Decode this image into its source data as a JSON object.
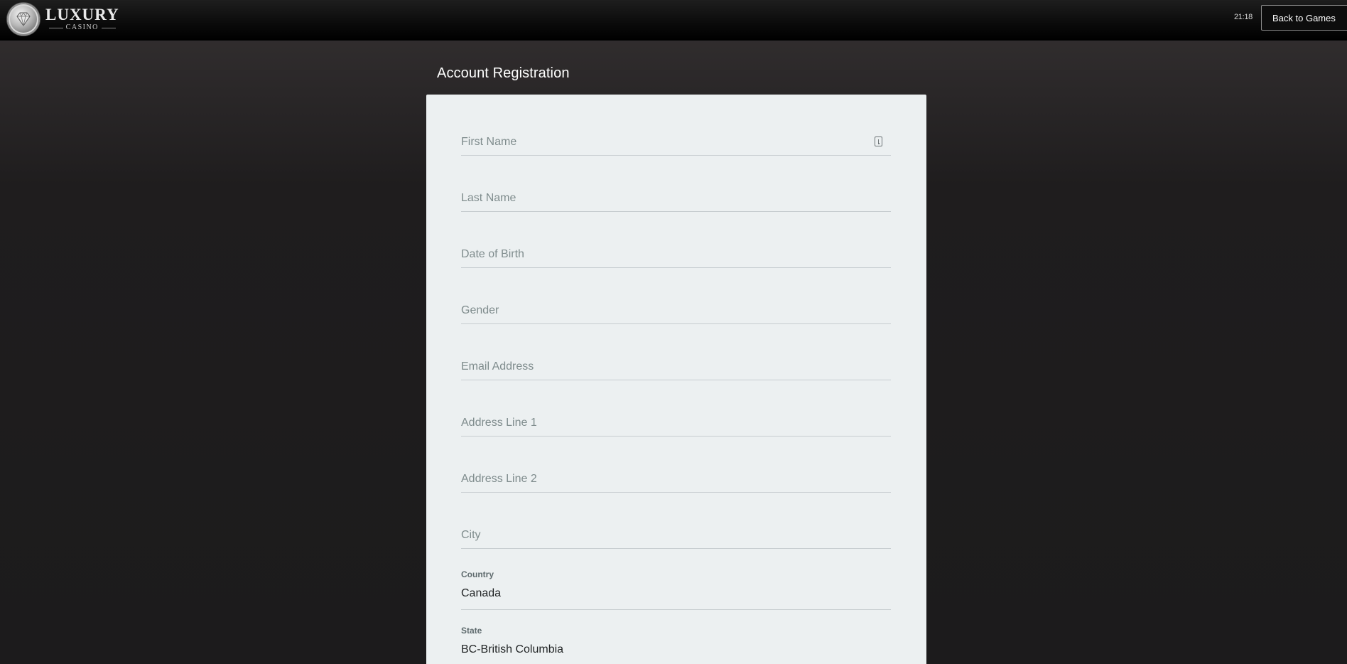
{
  "header": {
    "logo_main": "LUXURY",
    "logo_sub": "CASINO",
    "clock": "21:18",
    "back_button_label": "Back to Games"
  },
  "page": {
    "title": "Account Registration"
  },
  "form": {
    "fields": [
      {
        "name": "first-name",
        "placeholder": "First Name",
        "value": ""
      },
      {
        "name": "last-name",
        "placeholder": "Last Name",
        "value": ""
      },
      {
        "name": "date-of-birth",
        "placeholder": "Date of Birth",
        "value": ""
      },
      {
        "name": "gender",
        "placeholder": "Gender",
        "value": ""
      },
      {
        "name": "email-address",
        "placeholder": "Email Address",
        "value": ""
      },
      {
        "name": "address-line-1",
        "placeholder": "Address Line 1",
        "value": ""
      },
      {
        "name": "address-line-2",
        "placeholder": "Address Line 2",
        "value": ""
      },
      {
        "name": "city",
        "placeholder": "City",
        "value": ""
      }
    ],
    "country": {
      "label": "Country",
      "value": "Canada"
    },
    "state": {
      "label": "State",
      "value": "BC-British Columbia"
    }
  },
  "colors": {
    "card_background": "#ecf0f1",
    "placeholder_text": "#7f8c8d",
    "field_underline": "#c7cdd0",
    "page_background": "#1c1b1c"
  },
  "icons": {
    "logo": "diamond-emblem",
    "first_name_field": "contact-card-icon"
  }
}
